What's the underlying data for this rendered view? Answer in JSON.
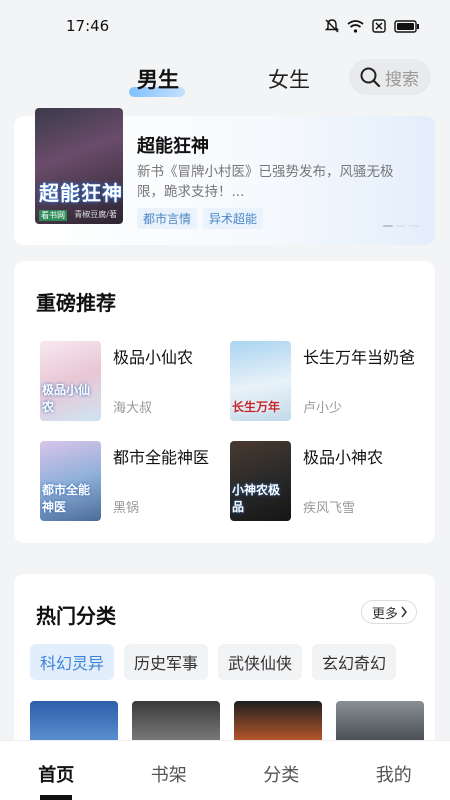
{
  "status": {
    "time": "17:46",
    "icons": [
      "mute-icon",
      "wifi-icon",
      "sim-icon",
      "battery-icon"
    ]
  },
  "top_tabs": {
    "male": "男生",
    "female": "女生",
    "active": "male"
  },
  "search": {
    "placeholder": "搜索"
  },
  "banner": {
    "title": "超能狂神",
    "description": "新书《冒牌小村医》已强势发布，风骚无极限，跪求支持！...",
    "tags": [
      "都市言情",
      "异术超能"
    ],
    "cover_title": "超能狂神",
    "cover_author": "青椒豆腐/著",
    "cover_badge": "看书网"
  },
  "recommend": {
    "title": "重磅推荐",
    "books": [
      {
        "name": "极品小仙农",
        "author": "海大叔",
        "cover_text": "极品小仙农"
      },
      {
        "name": "长生万年当奶爸",
        "author": "卢小少",
        "cover_text": "长生万年"
      },
      {
        "name": "都市全能神医",
        "author": "黑锅",
        "cover_text": "都市全能神医"
      },
      {
        "name": "极品小神农",
        "author": "疾风飞雪",
        "cover_text": "小神农极品"
      }
    ]
  },
  "hot": {
    "title": "热门分类",
    "more": "更多",
    "categories": [
      "科幻灵异",
      "历史军事",
      "武侠仙侠",
      "玄幻奇幻"
    ],
    "active_category": "科幻灵异"
  },
  "bottom_nav": [
    "首页",
    "书架",
    "分类",
    "我的"
  ],
  "colors": {
    "accent": "#3a83d6",
    "tag_bg": "#eaf2fb",
    "background": "#f3f4f6"
  }
}
